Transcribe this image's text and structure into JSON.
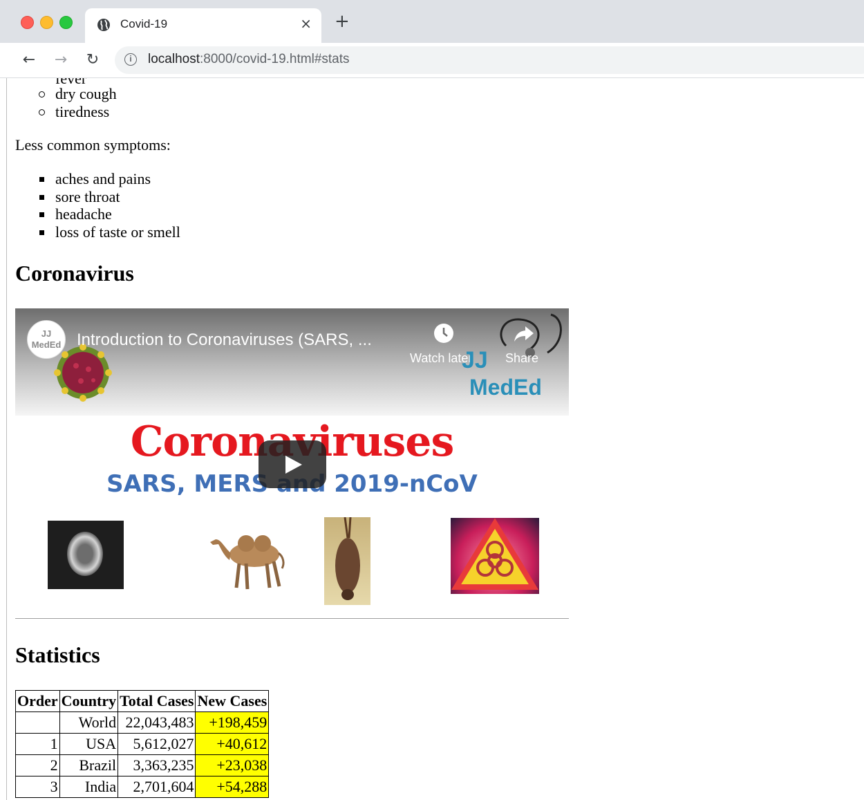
{
  "browser": {
    "tab_title": "Covid-19",
    "tab_close": "×",
    "new_tab": "+",
    "url_host": "localhost",
    "url_path": ":8000/covid-19.html#stats",
    "info_glyph": "i"
  },
  "page": {
    "partial_item": "fever",
    "common_symptoms": [
      "dry cough",
      "tiredness"
    ],
    "less_common_heading": "Less common symptoms:",
    "less_common_symptoms": [
      "aches and pains",
      "sore throat",
      "headache",
      "loss of taste or smell"
    ],
    "coronavirus_heading": "Coronavirus",
    "statistics_heading": "Statistics"
  },
  "video": {
    "channel_avatar_text": "JJ\nMedEd",
    "title": "Introduction to Coronaviruses (SARS, ...",
    "watch_later_label": "Watch later",
    "share_label": "Share",
    "logo_line1": "JJ",
    "logo_line2": "MedEd",
    "headline": "Coronaviruses",
    "subheadline": "SARS, MERS and 2019-nCoV"
  },
  "stats_table": {
    "headers": [
      "Order",
      "Country",
      "Total Cases",
      "New Cases"
    ],
    "rows": [
      {
        "order": "",
        "country": "World",
        "total": "22,043,483",
        "new": "+198,459"
      },
      {
        "order": "1",
        "country": "USA",
        "total": "5,612,027",
        "new": "+40,612"
      },
      {
        "order": "2",
        "country": "Brazil",
        "total": "3,363,235",
        "new": "+23,038"
      },
      {
        "order": "3",
        "country": "India",
        "total": "2,701,604",
        "new": "+54,288"
      }
    ]
  },
  "colors": {
    "new_cases_highlight": "#ffff00",
    "headline_red": "#e5181f",
    "subheadline_blue": "#3f6fb6",
    "logo_blue": "#2a8fb8"
  }
}
